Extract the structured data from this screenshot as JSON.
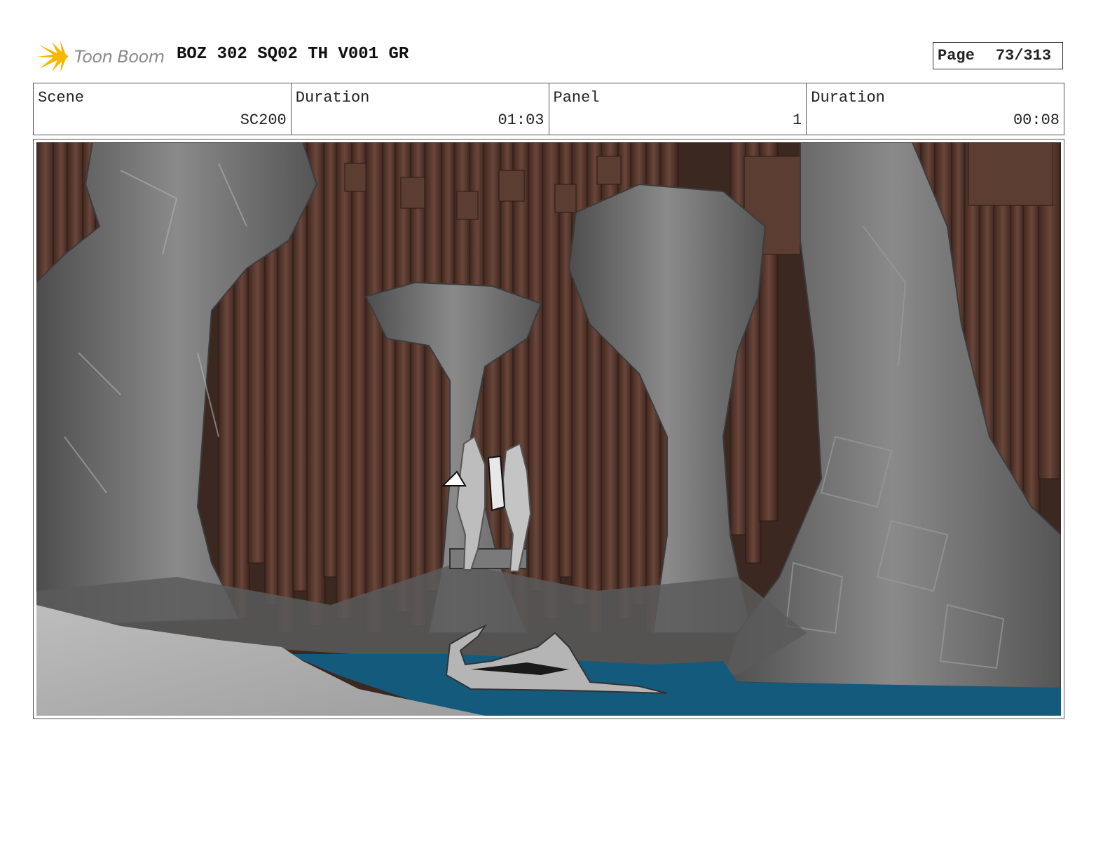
{
  "header": {
    "logo_text": "Toon Boom",
    "project_title": "BOZ 302 SQ02 TH V001 GR",
    "page_label": "Page",
    "page_number": "73/313"
  },
  "info": [
    {
      "label": "Scene",
      "value": "SC200"
    },
    {
      "label": "Duration",
      "value": "01:03"
    },
    {
      "label": "Panel",
      "value": "1"
    },
    {
      "label": "Duration",
      "value": "00:08"
    }
  ],
  "colors": {
    "logo_accent": "#f5b800",
    "water": "#145a7c",
    "rock": "#6e6e6e",
    "columns": "#5a3a2e"
  }
}
